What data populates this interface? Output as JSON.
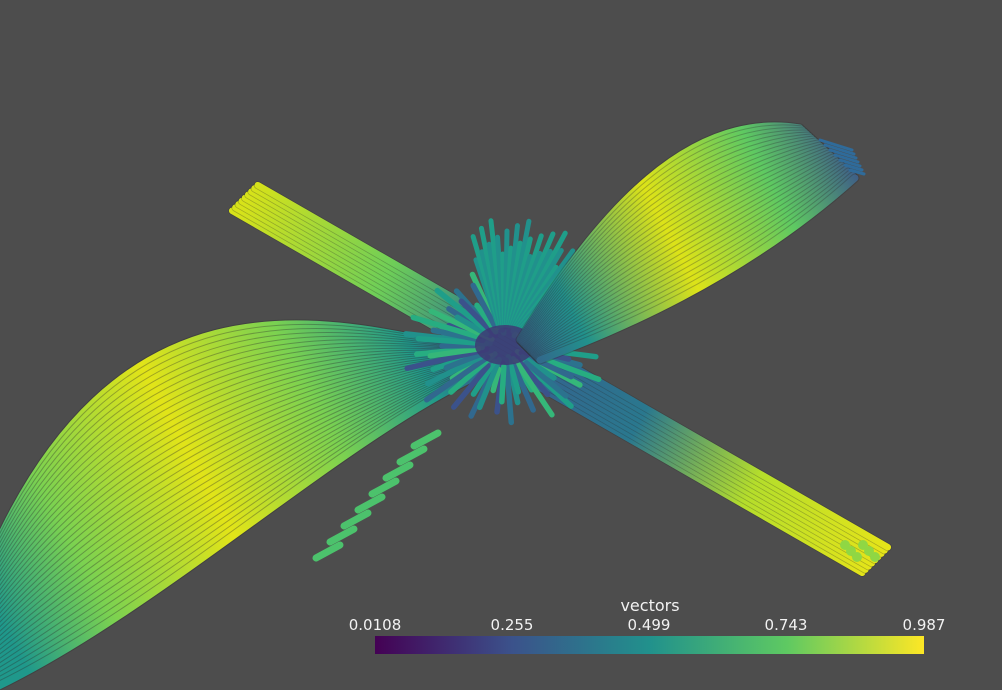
{
  "colorbar": {
    "title": "vectors",
    "ticks": [
      "0.0108",
      "0.255",
      "0.499",
      "0.743",
      "0.987"
    ],
    "colormap": [
      "#440154",
      "#3b528b",
      "#21918c",
      "#5ec962",
      "#fde725"
    ]
  },
  "colors": {
    "background": "#4d4d4d",
    "text": "#f2f2f2"
  }
}
